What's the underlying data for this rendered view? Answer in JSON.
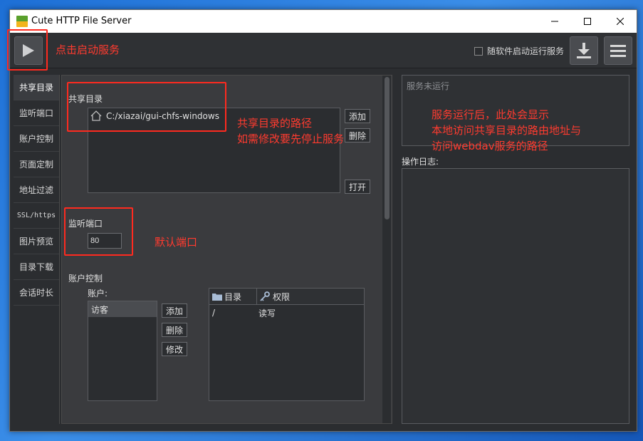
{
  "window": {
    "title": "Cute HTTP File Server",
    "icon_text": "CUTE HFS"
  },
  "toolbar": {
    "autostart_label": "随软件启动运行服务"
  },
  "annotations": {
    "play": "点击启动服务",
    "path": [
      "共享目录的路径",
      "如需修改要先停止服务"
    ],
    "port": "默认端口",
    "service": [
      "服务运行后，此处会显示",
      "本地访问共享目录的路由地址与",
      "访问webdav服务的路径"
    ]
  },
  "sidebar": {
    "items": [
      {
        "label": "共享目录",
        "icon": "share-dir"
      },
      {
        "label": "监听端口",
        "icon": "port"
      },
      {
        "label": "账户控制",
        "icon": "account"
      },
      {
        "label": "页面定制",
        "icon": "page"
      },
      {
        "label": "地址过滤",
        "icon": "filter"
      },
      {
        "label": "SSL/https",
        "icon": "ssl"
      },
      {
        "label": "图片预览",
        "icon": "image"
      },
      {
        "label": "目录下载",
        "icon": "download"
      },
      {
        "label": "会话时长",
        "icon": "session"
      }
    ]
  },
  "share": {
    "title": "共享目录",
    "path": "C:/xiazai/gui-chfs-windows",
    "add": "添加",
    "delete": "删除",
    "open": "打开"
  },
  "port": {
    "title": "监听端口",
    "value": "80"
  },
  "account": {
    "title": "账户控制",
    "users_label": "账户:",
    "users": [
      "访客"
    ],
    "add": "添加",
    "delete": "删除",
    "edit": "修改",
    "table": {
      "col_dir": "目录",
      "col_perm": "权限",
      "rows": [
        {
          "dir": "/",
          "perm": "读写"
        }
      ]
    }
  },
  "service": {
    "status": "服务未运行"
  },
  "log": {
    "title": "操作日志:"
  },
  "colors": {
    "annotation": "#ff3b2f",
    "window_bg": "#2b2d30"
  }
}
